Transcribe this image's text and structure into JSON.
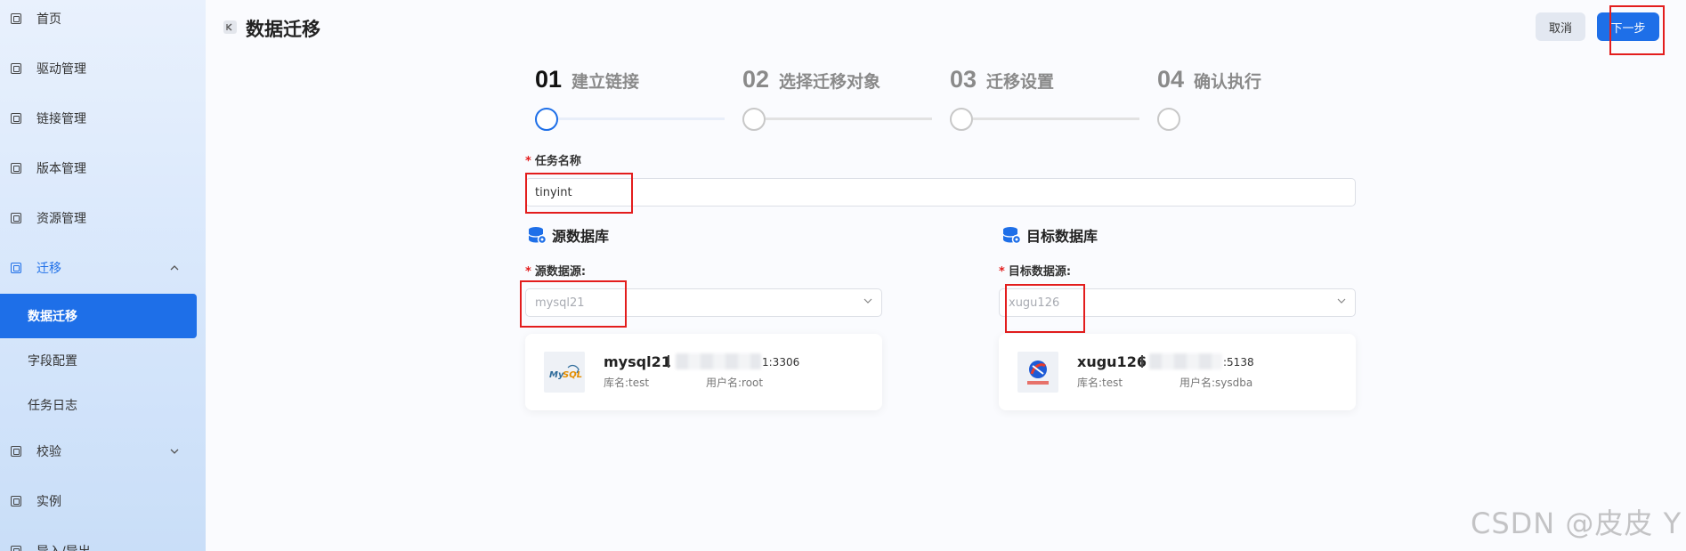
{
  "sidebar": {
    "items": [
      {
        "label": "首页"
      },
      {
        "label": "驱动管理"
      },
      {
        "label": "链接管理"
      },
      {
        "label": "版本管理"
      },
      {
        "label": "资源管理"
      },
      {
        "label": "迁移",
        "expanded": true
      },
      {
        "label": "校验",
        "expanded": false
      },
      {
        "label": "实例"
      },
      {
        "label": "导入/导出"
      }
    ],
    "migration_children": [
      {
        "label": "数据迁移",
        "selected": true
      },
      {
        "label": "字段配置"
      },
      {
        "label": "任务日志"
      }
    ],
    "accent_color": "#1e6fe8"
  },
  "header": {
    "title": "数据迁移",
    "cancel_label": "取消",
    "next_label": "下一步"
  },
  "steps": [
    {
      "num": "01",
      "label": "建立链接",
      "active": true
    },
    {
      "num": "02",
      "label": "选择迁移对象",
      "active": false
    },
    {
      "num": "03",
      "label": "迁移设置",
      "active": false
    },
    {
      "num": "04",
      "label": "确认执行",
      "active": false
    }
  ],
  "form": {
    "task_name_label": "任务名称",
    "task_name_value": "tinyint",
    "required_mark": "*"
  },
  "source": {
    "section_title": "源数据库",
    "field_label": "源数据源:",
    "selected": "mysql21",
    "card": {
      "name": "mysql21",
      "port_suffix": "1:3306",
      "db_name": "库名:test",
      "user": "用户名:root",
      "logo": "mysql-logo"
    }
  },
  "target": {
    "section_title": "目标数据库",
    "field_label": "目标数据源:",
    "selected": "xugu126",
    "card": {
      "name": "xugu126",
      "port_suffix": ":5138",
      "db_name": "库名:test",
      "user": "用户名:sysdba",
      "logo": "xugu-logo"
    }
  },
  "watermark": "CSDN @皮皮 Y"
}
